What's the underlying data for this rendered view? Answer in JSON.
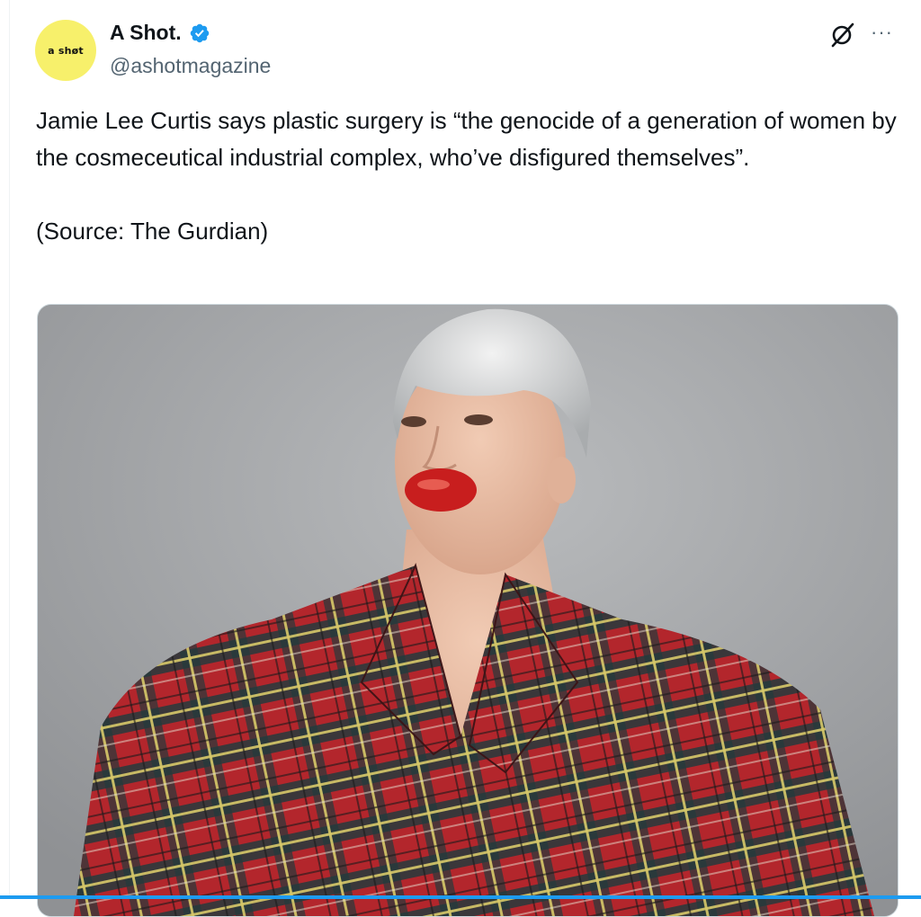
{
  "author": {
    "avatar_text": "a shøt",
    "display_name": "A Shot.",
    "handle": "@ashotmagazine",
    "verified": true
  },
  "icons": {
    "verified": "verified-badge-icon",
    "grok": "grok-icon",
    "more": "more-options-icon"
  },
  "more_glyph": "···",
  "tweet": {
    "text": "Jamie Lee Curtis says plastic surgery is “the genocide of a generation of women by the cosmeceutical industrial complex, who’ve disfigured themselves”.\n\n(Source: The Gurdian)"
  },
  "colors": {
    "verified_blue": "#1d9bf0",
    "avatar_yellow": "#f7f06b",
    "text_primary": "#0f1419",
    "text_secondary": "#536471"
  }
}
